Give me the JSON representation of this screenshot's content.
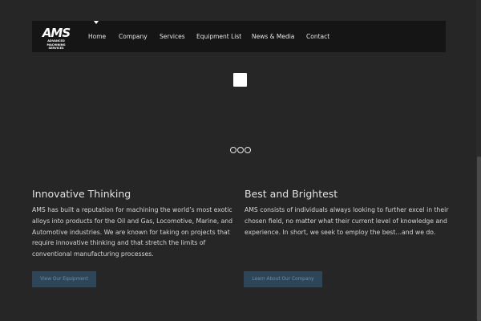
{
  "logo": {
    "main": "AMS",
    "sub": "ADVANCED MACHINING\nSERVICES"
  },
  "nav": {
    "items": [
      {
        "label": "Home",
        "active": true
      },
      {
        "label": "Company"
      },
      {
        "label": "Services"
      },
      {
        "label": "Equipment List"
      },
      {
        "label": "News & Media"
      },
      {
        "label": "Contact"
      }
    ]
  },
  "slider": {
    "dots": 3
  },
  "columns": [
    {
      "title": "Innovative Thinking",
      "text": "AMS has built a reputation for machining the world’s most exotic alloys into products for the Oil and Gas, Locomotive, Marine, and Automotive industries. We are known for taking on projects that require innovative thinking and that stretch the limits of conventional manufacturing processes.",
      "button": "View Our Equipment"
    },
    {
      "title": "Best and Brightest",
      "text": "AMS consists of individuals always looking to further excel in their chosen field, no matter what their current level of knowledge and experience. In short, we seek to employ the best…and we do.",
      "button": "Learn About Our Company"
    }
  ],
  "colors": {
    "background": "#262626",
    "navbar": "#151515",
    "button": "#2d4759",
    "button_text": "#6f8aa0"
  }
}
